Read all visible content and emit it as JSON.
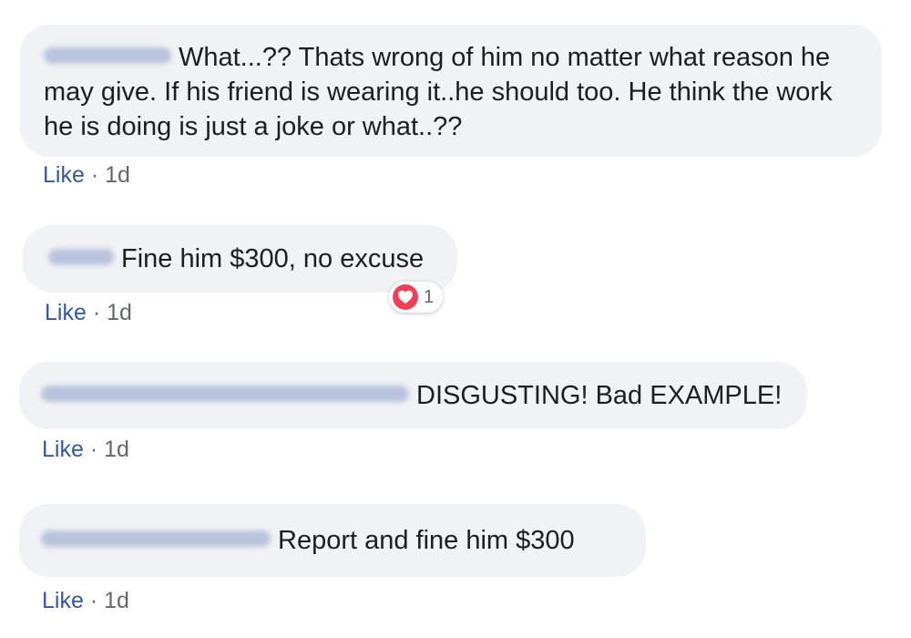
{
  "comments": [
    {
      "text": "What...?? Thats wrong of him no matter what reason he may give. If his friend is wearing it..he should too. He think the work he is doing is just a joke or what..??",
      "like_label": "Like",
      "separator": "·",
      "time": "1d"
    },
    {
      "text": "Fine him $300, no excuse",
      "like_label": "Like",
      "separator": "·",
      "time": "1d",
      "reaction": {
        "icon": "heart-icon",
        "count": "1",
        "color": "#f33e58"
      }
    },
    {
      "text": "DISGUSTING! Bad EXAMPLE!",
      "like_label": "Like",
      "separator": "·",
      "time": "1d"
    },
    {
      "text": "Report and fine him $300",
      "like_label": "Like",
      "separator": "·",
      "time": "1d"
    }
  ],
  "colors": {
    "bubble_bg": "#f0f2f5",
    "like_link": "#385898",
    "meta_text": "#65676b"
  }
}
